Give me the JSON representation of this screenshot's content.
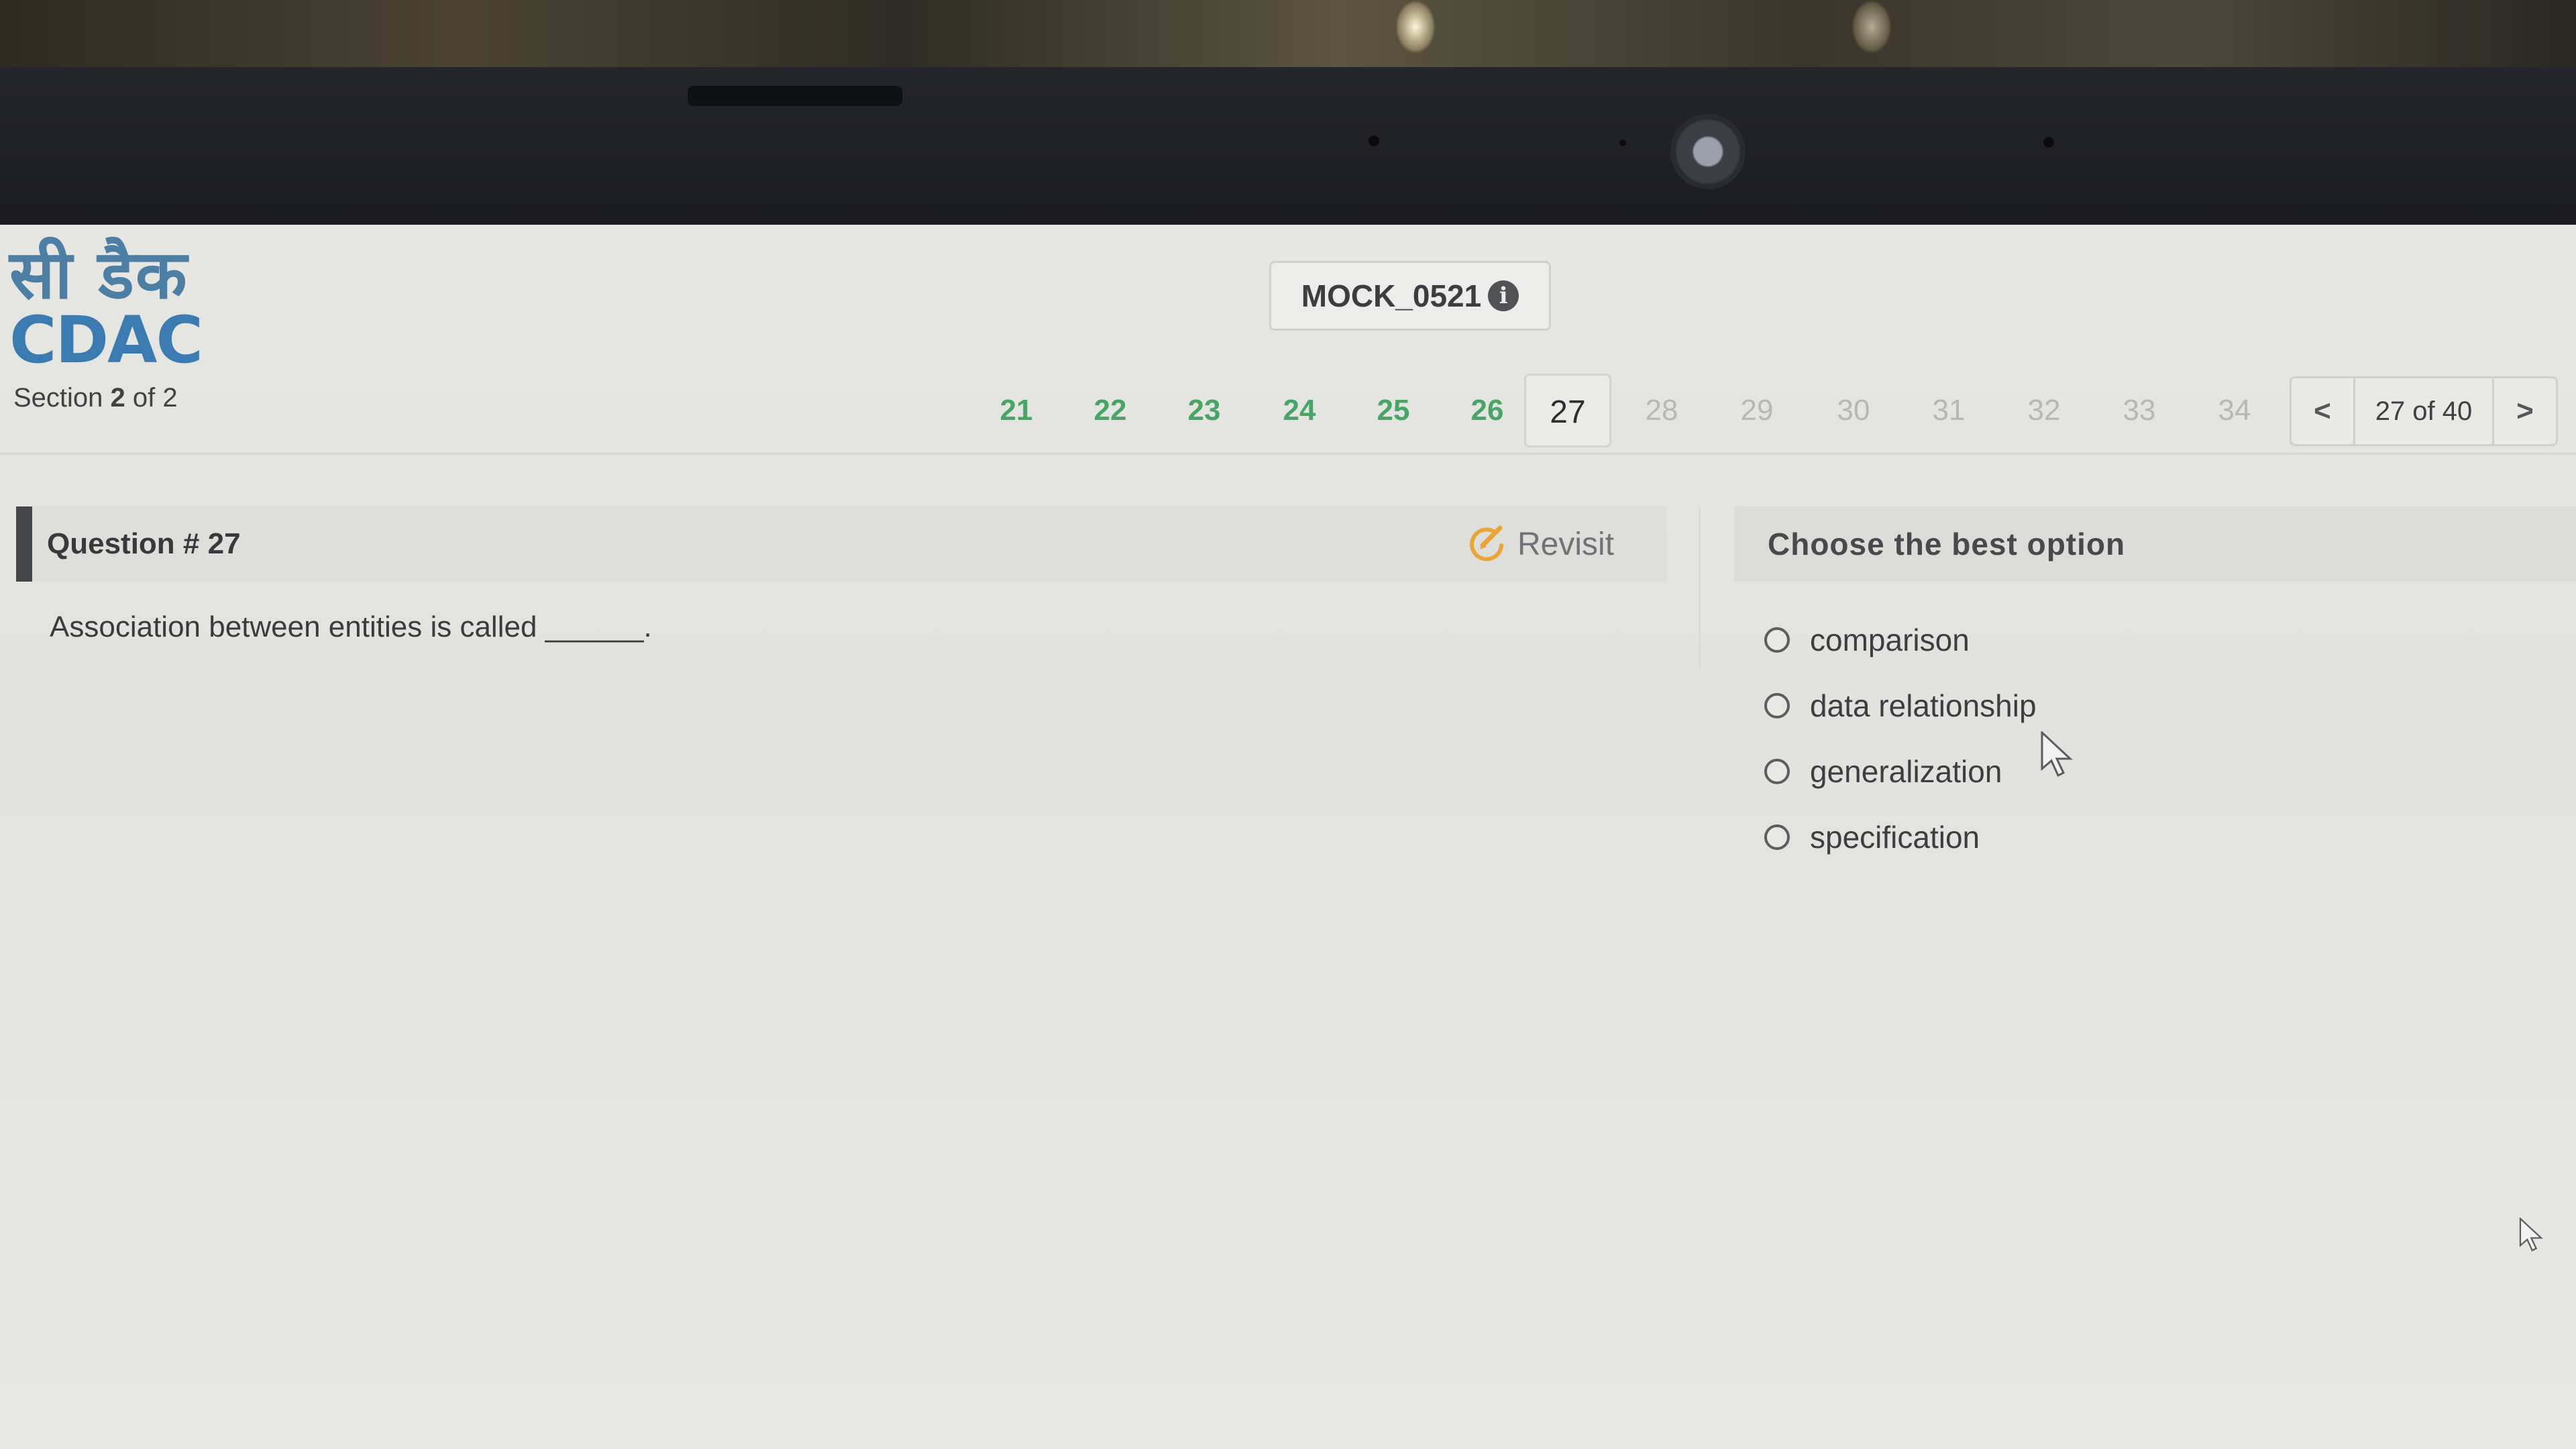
{
  "brand": {
    "hindi_name": "सी डैक",
    "name": "CDAC",
    "color": "#3b7bb1"
  },
  "section": {
    "prefix": "Section",
    "current": "2",
    "suffix": "of 2"
  },
  "exam": {
    "title": "MOCK_0521",
    "info_icon": "info-icon"
  },
  "question_nav": {
    "items": [
      {
        "number": "21",
        "status": "answered"
      },
      {
        "number": "22",
        "status": "answered"
      },
      {
        "number": "23",
        "status": "answered"
      },
      {
        "number": "24",
        "status": "answered"
      },
      {
        "number": "25",
        "status": "answered"
      },
      {
        "number": "26",
        "status": "answered"
      },
      {
        "number": "27",
        "status": "current"
      },
      {
        "number": "28",
        "status": "unvisited"
      },
      {
        "number": "29",
        "status": "unvisited"
      },
      {
        "number": "30",
        "status": "unvisited"
      },
      {
        "number": "31",
        "status": "unvisited"
      },
      {
        "number": "32",
        "status": "unvisited"
      },
      {
        "number": "33",
        "status": "unvisited"
      },
      {
        "number": "34",
        "status": "unvisited"
      }
    ],
    "answered_color": "#48a565",
    "prev_label": "<",
    "next_label": ">",
    "position_label": "27 of 40"
  },
  "question": {
    "heading": "Question # 27",
    "revisit_label": "Revisit",
    "text": "Association between entities is called ______."
  },
  "answer_panel": {
    "heading": "Choose the best option",
    "options": [
      "comparison",
      "data relationship",
      "generalization",
      "specification"
    ]
  }
}
